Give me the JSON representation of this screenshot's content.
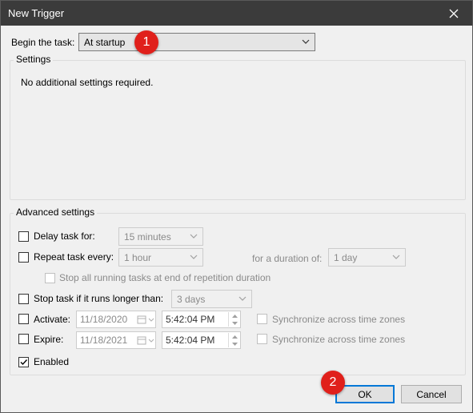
{
  "window": {
    "title": "New Trigger"
  },
  "begin": {
    "label": "Begin the task:",
    "value": "At startup"
  },
  "settings": {
    "group_title": "Settings",
    "message": "No additional settings required."
  },
  "advanced": {
    "group_title": "Advanced settings",
    "delay": {
      "label": "Delay task for:",
      "value": "15 minutes",
      "checked": false
    },
    "repeat": {
      "label": "Repeat task every:",
      "value": "1 hour",
      "checked": false,
      "duration_label": "for a duration of:",
      "duration_value": "1 day"
    },
    "stop_running": {
      "label": "Stop all running tasks at end of repetition duration",
      "checked": false
    },
    "stop_longer": {
      "label": "Stop task if it runs longer than:",
      "value": "3 days",
      "checked": false
    },
    "activate": {
      "label": "Activate:",
      "date": "11/18/2020",
      "time": "5:42:04 PM",
      "checked": false,
      "sync_label": "Synchronize across time zones"
    },
    "expire": {
      "label": "Expire:",
      "date": "11/18/2021",
      "time": "5:42:04 PM",
      "checked": false,
      "sync_label": "Synchronize across time zones"
    },
    "enabled": {
      "label": "Enabled",
      "checked": true
    }
  },
  "buttons": {
    "ok": "OK",
    "cancel": "Cancel"
  },
  "annotations": {
    "marker1": "1",
    "marker2": "2"
  },
  "colors": {
    "titlebar": "#3b3b3b",
    "dialog_bg": "#f0f0f0",
    "focus_border": "#0078d7",
    "badge": "#e0201b"
  },
  "icons": [
    "close-icon",
    "chevron-down-icon",
    "calendar-icon",
    "spin-up-icon",
    "spin-down-icon",
    "checkmark-icon"
  ]
}
